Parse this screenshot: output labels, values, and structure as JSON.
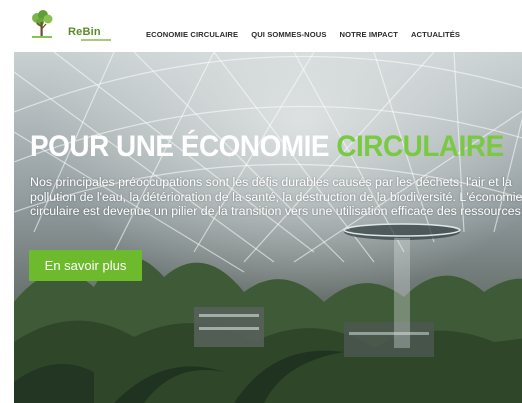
{
  "header": {
    "logo_text": "ReBin",
    "nav": [
      {
        "label": "ECONOMIE CIRCULAIRE"
      },
      {
        "label": "QUI SOMMES-NOUS"
      },
      {
        "label": "NOTRE IMPACT"
      },
      {
        "label": "ACTUALITÉS"
      }
    ]
  },
  "hero": {
    "title_main": "POUR UNE ÉCONOMIE ",
    "title_accent": "CIRCULAIRE",
    "description": "Nos principales préoccupations sont les défis durables causés par les déchets, l'air et la pollution de l'eau, la détérioration de la santé, la destruction de la biodiversité. L'économie circulaire est devenue un pilier de la transition vers une utilisation efficace des ressources.",
    "cta_label": "En savoir plus"
  },
  "colors": {
    "accent_green": "#7ac943",
    "button_green": "#6dbb2c",
    "nav_text": "#2b2b2b"
  }
}
